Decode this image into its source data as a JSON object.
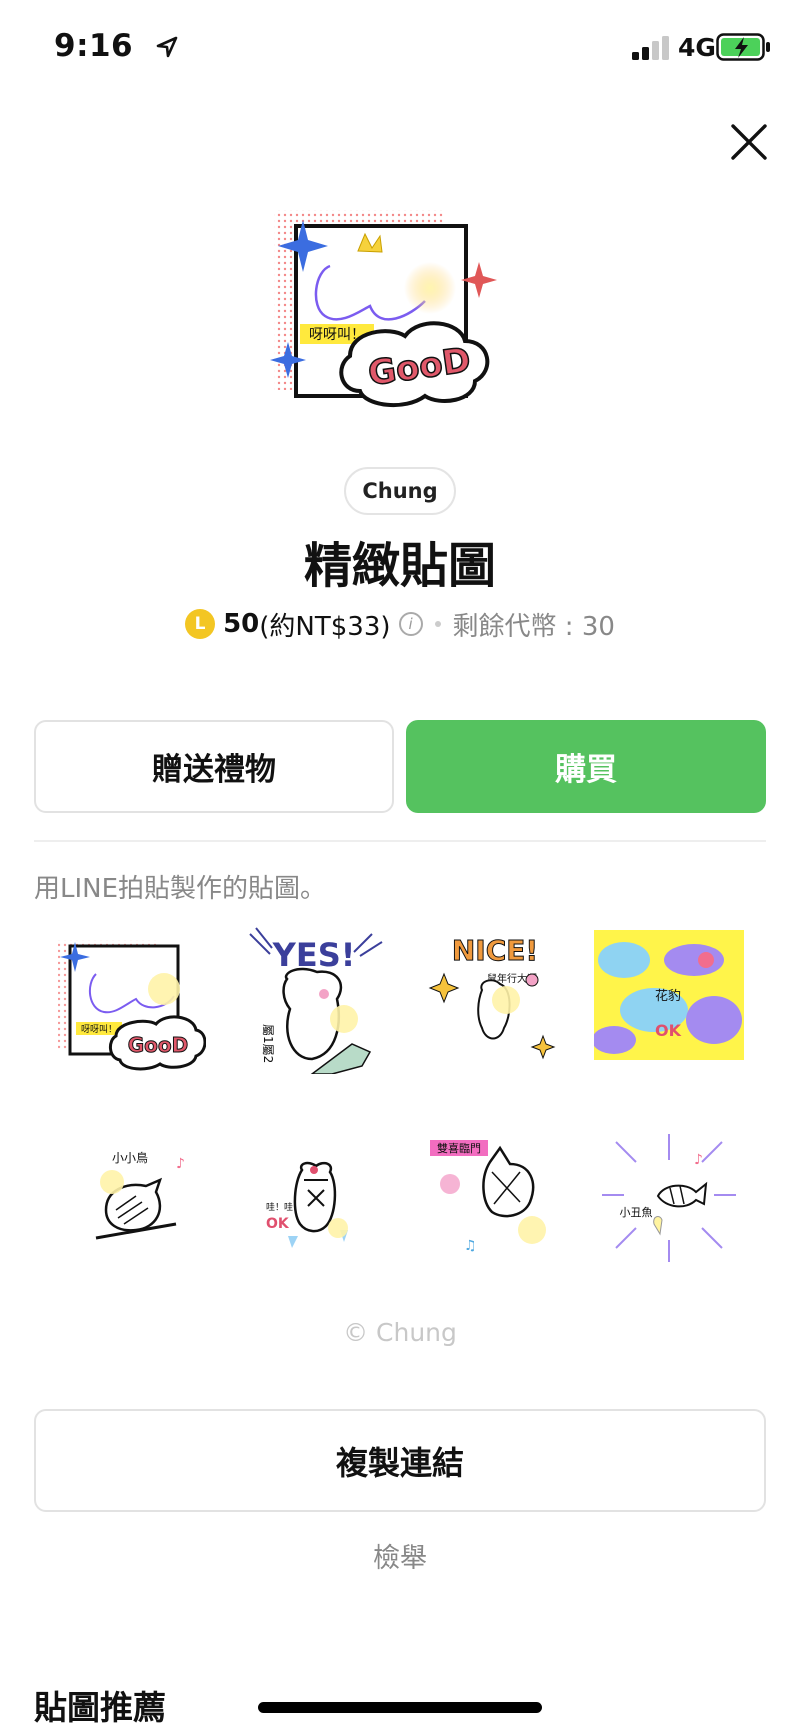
{
  "status_bar": {
    "time": "9:16",
    "network": "4G"
  },
  "hero": {
    "speech_text": "呀呀叫！",
    "badge_text": "GooD"
  },
  "author": "Chung",
  "title": "精緻貼圖",
  "price": {
    "coin_letter": "L",
    "amount": "50",
    "approx": "(約NT$33)",
    "info_icon": "i",
    "remaining": "剩餘代幣 : 30"
  },
  "actions": {
    "gift_label": "贈送禮物",
    "buy_label": "購買"
  },
  "colors": {
    "buy_green": "#55c25f",
    "coin_yellow": "#f3c623"
  },
  "description": "用LINE拍貼製作的貼圖。",
  "stickers": [
    {
      "caption": "呀呀叫！",
      "badge": "GooD"
    },
    {
      "caption": "YES!",
      "sub": "屬1屬2"
    },
    {
      "caption": "NICE!",
      "sub": "鼠年行大運"
    },
    {
      "caption": "花豹",
      "badge": "OK"
    },
    {
      "caption": "小小鳥"
    },
    {
      "caption": "哇！哇！",
      "badge": "OK"
    },
    {
      "caption": "雙喜臨門"
    },
    {
      "caption": "小丑魚"
    }
  ],
  "copyright": "© Chung",
  "copy_link_label": "複製連結",
  "report_label": "檢舉",
  "recommend_title": "貼圖推薦"
}
